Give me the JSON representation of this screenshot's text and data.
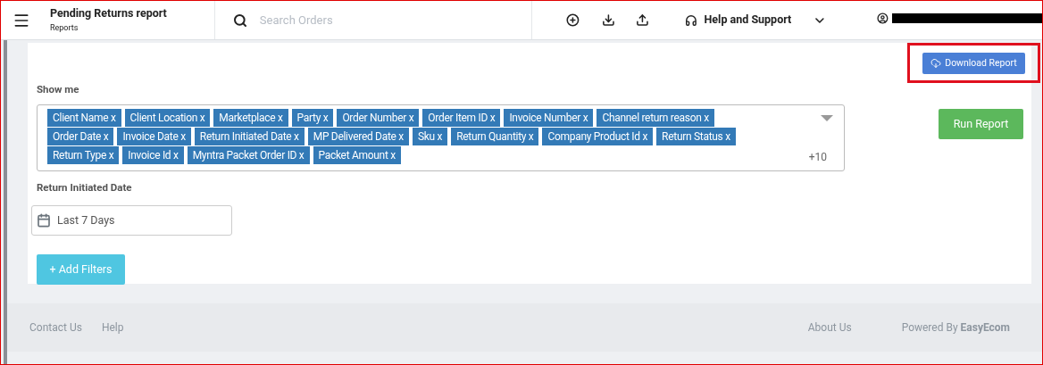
{
  "header": {
    "title": "Pending Returns report",
    "subtitle": "Reports",
    "search": {
      "placeholder": "Search Orders"
    },
    "help": "Help and Support"
  },
  "download_button": "Download Report",
  "show_me": {
    "label": "Show me",
    "more": "+10",
    "tag_rows": [
      [
        "Client Name x",
        "Client Location x",
        "Marketplace x",
        "Party x",
        "Order Number x",
        "Order Item ID x",
        "Invoice Number x",
        "Channel return reason x"
      ],
      [
        "Order Date x",
        "Invoice Date x",
        "Return Initiated Date x",
        "MP Delivered Date x",
        "Sku x",
        "Return Quantity x",
        "Company Product Id x",
        "Return Status x"
      ],
      [
        "Return Type x",
        "Invoice Id x",
        "Myntra Packet Order ID x",
        "Packet Amount x"
      ]
    ]
  },
  "run_button": "Run Report",
  "date_filter": {
    "label": "Return Initiated Date",
    "value": "Last 7 Days"
  },
  "add_filters": "+ Add Filters",
  "footer": {
    "left": [
      "Contact Us",
      "Help"
    ],
    "about": "About Us",
    "powered": "Powered By **EasyEcom**"
  }
}
